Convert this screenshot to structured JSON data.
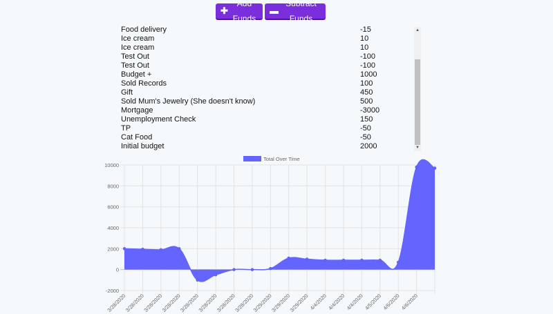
{
  "toolbar": {
    "add_label": "Add Funds",
    "add_icon": "plus-icon",
    "subtract_label": "Subtract Funds",
    "subtract_icon": "minus-icon",
    "button_color": "#7b2fdc"
  },
  "transactions": [
    {
      "name": "Food delivery",
      "amount": "-15"
    },
    {
      "name": "Ice cream",
      "amount": "10"
    },
    {
      "name": "Ice cream",
      "amount": "10"
    },
    {
      "name": "Test Out",
      "amount": "-100"
    },
    {
      "name": "Test Out",
      "amount": "-100"
    },
    {
      "name": "Budget +",
      "amount": "1000"
    },
    {
      "name": "Sold Records",
      "amount": "100"
    },
    {
      "name": "Gift",
      "amount": "450"
    },
    {
      "name": "Sold Mum's Jewelry (She doesn't know)",
      "amount": "500"
    },
    {
      "name": "Mortgage",
      "amount": "-3000"
    },
    {
      "name": "Unemployment Check",
      "amount": "150"
    },
    {
      "name": "TP",
      "amount": "-50"
    },
    {
      "name": "Cat Food",
      "amount": "-50"
    },
    {
      "name": "Initial budget",
      "amount": "2000"
    }
  ],
  "chart_data": {
    "type": "area",
    "legend": [
      "Total Over Time"
    ],
    "legend_position": "top-center",
    "grid": true,
    "series_color": "#6465ff",
    "x": [
      "3/28/2020",
      "3/28/2020",
      "3/28/2020",
      "3/28/2020",
      "3/28/2020",
      "3/28/2020",
      "3/28/2020",
      "3/28/2020",
      "3/29/2020",
      "3/29/2020",
      "3/29/2020",
      "4/4/2020",
      "4/4/2020",
      "4/4/2020",
      "4/5/2020",
      "4/6/2020",
      "4/6/2020"
    ],
    "series": [
      {
        "name": "Total Over Time",
        "values": [
          2000,
          1950,
          1900,
          2000,
          -1000,
          -500,
          0,
          0,
          100,
          1100,
          1000,
          900,
          900,
          900,
          900,
          700,
          9800,
          9700
        ]
      }
    ],
    "y_ticks": [
      -2000,
      0,
      2000,
      4000,
      6000,
      8000,
      10000
    ],
    "ylim": [
      -2000,
      10000
    ]
  }
}
